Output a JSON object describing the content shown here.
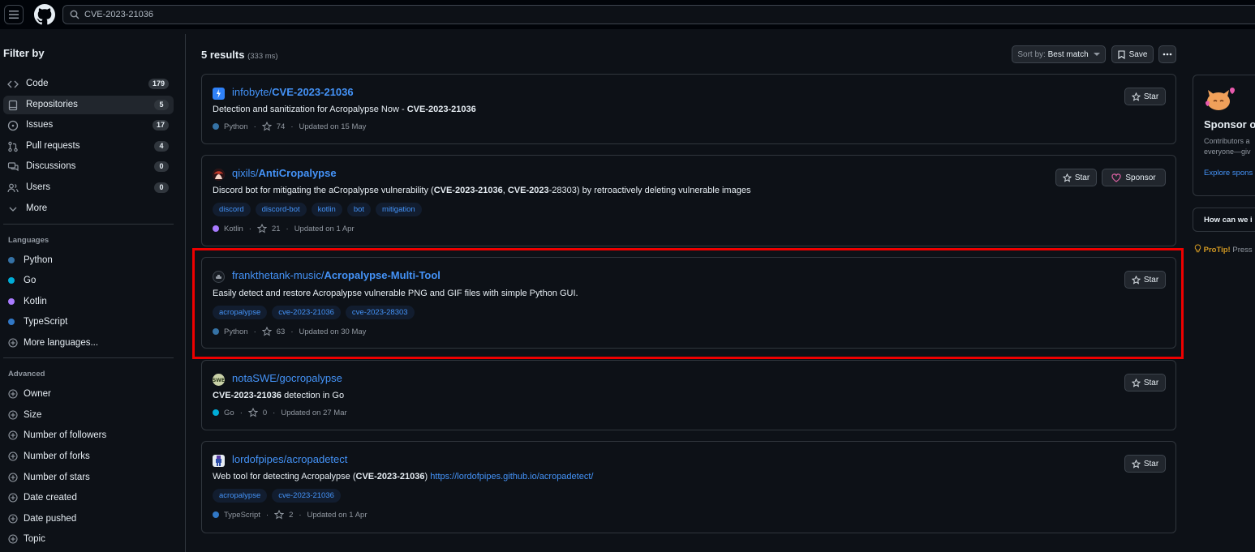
{
  "header": {
    "search_value": "CVE-2023-21036"
  },
  "sidebar": {
    "title": "Filter by",
    "nav": [
      {
        "label": "Code",
        "count": "179"
      },
      {
        "label": "Repositories",
        "count": "5"
      },
      {
        "label": "Issues",
        "count": "17"
      },
      {
        "label": "Pull requests",
        "count": "4"
      },
      {
        "label": "Discussions",
        "count": "0"
      },
      {
        "label": "Users",
        "count": "0"
      },
      {
        "label": "More"
      }
    ],
    "languages_title": "Languages",
    "languages": [
      {
        "label": "Python",
        "color": "#3572A5"
      },
      {
        "label": "Go",
        "color": "#00ADD8"
      },
      {
        "label": "Kotlin",
        "color": "#A97BFF"
      },
      {
        "label": "TypeScript",
        "color": "#3178c6"
      }
    ],
    "more_languages": "More languages...",
    "advanced_title": "Advanced",
    "advanced": [
      "Owner",
      "Size",
      "Number of followers",
      "Number of forks",
      "Number of stars",
      "Date created",
      "Date pushed",
      "Topic"
    ]
  },
  "main": {
    "results_label": "5 results",
    "results_time": "(333 ms)",
    "sort_prefix": "Sort by:",
    "sort_value": "Best match",
    "save_label": "Save",
    "star_label": "Star",
    "sponsor_label": "Sponsor",
    "results": [
      {
        "owner": "infobyte/",
        "name": "CVE-2023-21036",
        "desc_pre": "Detection and sanitization for Acropalypse Now - ",
        "desc_bold": "CVE-2023-21036",
        "language": "Python",
        "stars": "74",
        "updated": "Updated on 15 May"
      },
      {
        "owner": "qixils/",
        "name": "AntiCropalypse",
        "desc_a": "Discord bot for mitigating the aCropalypse vulnerability (",
        "desc_b1": "CVE-2023-21036",
        "desc_c": ", ",
        "desc_b2": "CVE-2023",
        "desc_d": "-28303) by retroactively deleting vulnerable images",
        "tags": [
          "discord",
          "discord-bot",
          "kotlin",
          "bot",
          "mitigation"
        ],
        "language": "Kotlin",
        "stars": "21",
        "updated": "Updated on 1 Apr"
      },
      {
        "owner": "frankthetank-music/",
        "name": "Acropalypse-Multi-Tool",
        "desc": "Easily detect and restore Acropalypse vulnerable PNG and GIF files with simple Python GUI.",
        "tags": [
          "acropalypse",
          "cve-2023-21036",
          "cve-2023-28303"
        ],
        "language": "Python",
        "stars": "63",
        "updated": "Updated on 30 May"
      },
      {
        "owner": "notaSWE/",
        "name": "gocropalypse",
        "desc_bold": "CVE-2023-21036",
        "desc_post": " detection in Go",
        "language": "Go",
        "stars": "0",
        "updated": "Updated on 27 Mar"
      },
      {
        "owner": "lordofpipes/",
        "name": "acropadetect",
        "desc_pre": "Web tool for detecting Acropalypse (",
        "desc_bold": "CVE-2023-21036",
        "desc_mid": ") ",
        "desc_link": "https://lordofpipes.github.io/acropadetect/",
        "tags": [
          "acropalypse",
          "cve-2023-21036"
        ],
        "language": "TypeScript",
        "stars": "2",
        "updated": "Updated on 1 Apr"
      }
    ]
  },
  "right": {
    "sponsor_title": "Sponsor op",
    "sponsor_text_1": "Contributors a",
    "sponsor_text_2": "everyone—giv",
    "sponsor_link": "Explore spons",
    "help_title": "How can we i",
    "protip_label": "ProTip!",
    "protip_text": " Press"
  },
  "colors": {
    "accent": "#4493f8",
    "highlight": "#e00000"
  }
}
